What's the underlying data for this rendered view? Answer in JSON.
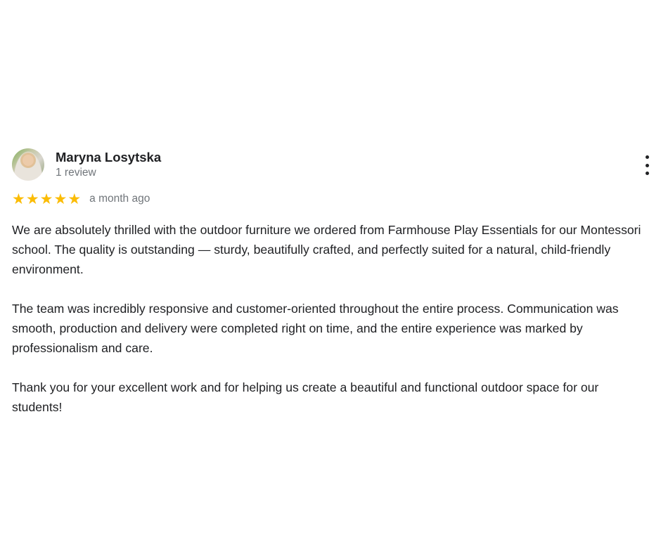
{
  "review": {
    "author_name": "Maryna Losytska",
    "review_count": "1 review",
    "rating": 5,
    "rating_max": 5,
    "stars": [
      "★",
      "★",
      "★",
      "★",
      "★"
    ],
    "star_color": "#fbbc04",
    "date": "a month ago",
    "paragraphs": [
      "We are absolutely thrilled with the outdoor furniture we ordered from Farmhouse Play Essentials for our Montessori school. The quality is outstanding — sturdy, beautifully crafted, and perfectly suited for a natural, child-friendly environment.",
      "The team was incredibly responsive and customer-oriented throughout the entire process. Communication was smooth, production and delivery were completed right on time, and the entire experience was marked by professionalism and care.",
      "Thank you for your excellent work and for helping us create a beautiful and functional outdoor space for our students!"
    ],
    "menu_icon": "more-vert-icon"
  }
}
